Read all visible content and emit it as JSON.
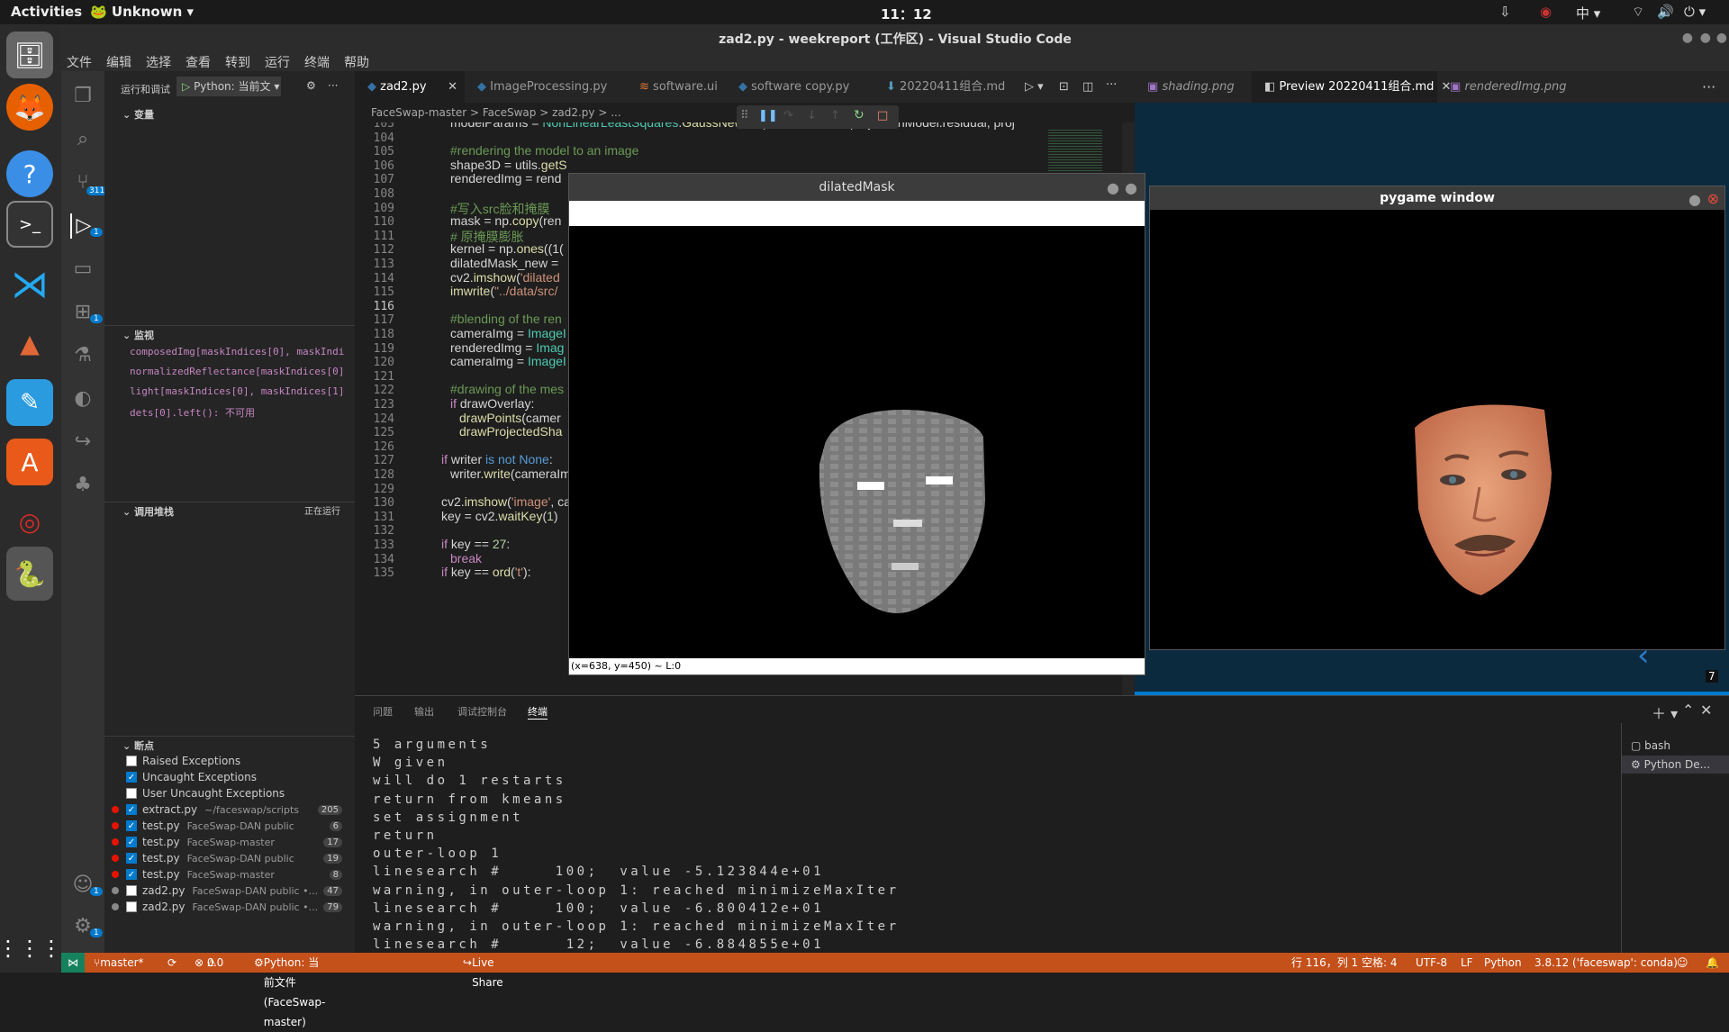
{
  "topbar": {
    "activities": "Activities",
    "app": "Unknown",
    "clock": "11：12",
    "input_method": "中"
  },
  "window_title": "zad2.py - weekreport (工作区) - Visual Studio Code",
  "menu": [
    "文件",
    "编辑",
    "选择",
    "查看",
    "转到",
    "运行",
    "终端",
    "帮助"
  ],
  "sidebar": {
    "run_label": "运行和调试",
    "config": "Python: 当前文",
    "variables": "变量",
    "watch_header": "监视",
    "watch": [
      "composedImg[maskIndices[0], maskIndi",
      "normalizedReflectance[maskIndices[0]",
      "light[maskIndices[0], maskIndices[1]",
      "dets[0].left(): 不可用"
    ],
    "callstack_header": "调用堆栈",
    "callstack_state": "正在运行",
    "breakpoints_header": "断点",
    "exceptions": [
      {
        "label": "Raised Exceptions",
        "checked": false
      },
      {
        "label": "Uncaught Exceptions",
        "checked": true
      },
      {
        "label": "User Uncaught Exceptions",
        "checked": false
      }
    ],
    "breakpoints": [
      {
        "file": "extract.py",
        "path": "~/faceswap/scripts",
        "line": "205",
        "checked": true,
        "dot": "#e51400"
      },
      {
        "file": "test.py",
        "path": "FaceSwap-DAN public",
        "line": "6",
        "checked": true,
        "dot": "#e51400"
      },
      {
        "file": "test.py",
        "path": "FaceSwap-master",
        "line": "17",
        "checked": true,
        "dot": "#e51400"
      },
      {
        "file": "test.py",
        "path": "FaceSwap-DAN public",
        "line": "19",
        "checked": true,
        "dot": "#e51400"
      },
      {
        "file": "test.py",
        "path": "FaceSwap-master",
        "line": "8",
        "checked": true,
        "dot": "#e51400"
      },
      {
        "file": "zad2.py",
        "path": "FaceSwap-DAN public •...",
        "line": "47",
        "checked": false,
        "dot": "#888888"
      },
      {
        "file": "zad2.py",
        "path": "FaceSwap-DAN public •...",
        "line": "79",
        "checked": false,
        "dot": "#888888"
      }
    ]
  },
  "editor_tabs": [
    "zad2.py",
    "ImageProcessing.py",
    "software.ui",
    "software copy.py",
    "20220411组合.md"
  ],
  "preview_tabs": [
    "shading.png",
    "Preview 20220411组合.md",
    "renderedImg.png"
  ],
  "breadcrumb": "FaceSwap-master  >  FaceSwap  >  zad2.py  >  ...",
  "code_lines": [
    {
      "n": "103",
      "html": "modelParams = <span class='cl'>NonLinearLeastSquares</span>.<span class='fn'>GaussNewton</span>(modelParams, projectionModel.residual, proj",
      "indent": 1
    },
    {
      "n": "104",
      "html": "",
      "indent": 1
    },
    {
      "n": "105",
      "html": "<span class='cm'>#rendering the model to an image</span>",
      "indent": 1
    },
    {
      "n": "106",
      "html": "shape3D = utils.<span class='fn'>getS</span>",
      "indent": 1
    },
    {
      "n": "107",
      "html": "renderedImg = rend",
      "indent": 1
    },
    {
      "n": "108",
      "html": "",
      "indent": 1
    },
    {
      "n": "109",
      "html": "<span class='cm'>#写入src脸和掩膜</span>",
      "indent": 1
    },
    {
      "n": "110",
      "html": "mask = np.<span class='fn'>copy</span>(ren",
      "indent": 1
    },
    {
      "n": "111",
      "html": "<span class='cm'># 原掩膜膨胀</span>",
      "indent": 1
    },
    {
      "n": "112",
      "html": "kernel = np.<span class='fn'>ones</span>((1(",
      "indent": 1
    },
    {
      "n": "113",
      "html": "dilatedMask_new =",
      "indent": 1
    },
    {
      "n": "114",
      "html": "cv2.<span class='fn'>imshow</span>(<span class='st'>'dilated</span>",
      "indent": 1
    },
    {
      "n": "115",
      "html": "<span class='fn'>imwrite</span>(<span class='st'>\"../data/src/</span>",
      "indent": 1
    },
    {
      "n": "116",
      "html": "",
      "indent": 1
    },
    {
      "n": "117",
      "html": "<span class='cm'>#blending of the ren</span>",
      "indent": 1
    },
    {
      "n": "118",
      "html": "cameraImg = <span class='cl'>ImageI</span>",
      "indent": 1
    },
    {
      "n": "119",
      "html": "renderedImg = <span class='cl'>Imag</span>",
      "indent": 1
    },
    {
      "n": "120",
      "html": "cameraImg = <span class='cl'>ImageI</span>",
      "indent": 1
    },
    {
      "n": "121",
      "html": "",
      "indent": 1
    },
    {
      "n": "122",
      "html": "<span class='cm'>#drawing of the mes</span>",
      "indent": 1
    },
    {
      "n": "123",
      "html": "<span class='kw'>if</span> drawOverlay:",
      "indent": 1
    },
    {
      "n": "124",
      "html": "<span class='fn'>drawPoints</span>(camer",
      "indent": 2
    },
    {
      "n": "125",
      "html": "<span class='fn'>drawProjectedSha</span>",
      "indent": 2
    },
    {
      "n": "126",
      "html": "",
      "indent": 0
    },
    {
      "n": "127",
      "html": "<span class='kw'>if</span> writer <span class='bl'>is not None</span>:",
      "indent": 0
    },
    {
      "n": "128",
      "html": "writer.<span class='fn'>write</span>(cameraIm",
      "indent": 1
    },
    {
      "n": "129",
      "html": "",
      "indent": 0
    },
    {
      "n": "130",
      "html": "cv2.<span class='fn'>imshow</span>(<span class='st'>'image'</span>, ca",
      "indent": 0
    },
    {
      "n": "131",
      "html": "key = cv2.<span class='fn'>waitKey</span>(<span class='nb'>1</span>)",
      "indent": 0
    },
    {
      "n": "132",
      "html": "",
      "indent": 0
    },
    {
      "n": "133",
      "html": "<span class='kw'>if</span> key == <span class='nb'>27</span>:",
      "indent": 0
    },
    {
      "n": "134",
      "html": "<span class='kw'>break</span>",
      "indent": 1
    },
    {
      "n": "135",
      "html": "<span class='kw'>if</span> key == <span class='fn'>ord</span>(<span class='st'>'t'</span>):",
      "indent": 0
    }
  ],
  "dialog1": {
    "title": "dilatedMask",
    "status": "(x=638, y=450) ~ L:0"
  },
  "dialog2": {
    "title": "pygame window"
  },
  "panel_tabs": [
    "问题",
    "输出",
    "调试控制台",
    "终端"
  ],
  "terminal_lines": [
    "5 arguments",
    "W given",
    "will do 1 restarts",
    "return from kmeans",
    "set assignment",
    "return",
    "outer-loop 1",
    "linesearch #     100;  value -5.123844e+01",
    "warning, in outer-loop 1: reached minimizeMaxIter",
    "linesearch #     100;  value -6.800412e+01",
    "warning, in outer-loop 1: reached minimizeMaxIter",
    "linesearch #      12;  value -6.884855e+01"
  ],
  "terminal_list": [
    "bash",
    "Python De..."
  ],
  "preview_page": "7",
  "status": {
    "branch": "master*",
    "errors": "0",
    "warnings": "0",
    "interpreter": "Python: 当前文件 (FaceSwap-master)",
    "live_share": "Live Share",
    "position": "行 116，列 1",
    "spaces": "空格: 4",
    "encoding": "UTF-8",
    "eol": "LF",
    "language": "Python",
    "env": "3.8.12 ('faceswap': conda)"
  },
  "badges": {
    "scm": "311",
    "debug": "1",
    "extensions": "1",
    "accounts": "1",
    "settings": "1"
  },
  "colors": {
    "statusbar": "#c4501a",
    "accent": "#007acc",
    "breakpoint": "#e51400"
  }
}
